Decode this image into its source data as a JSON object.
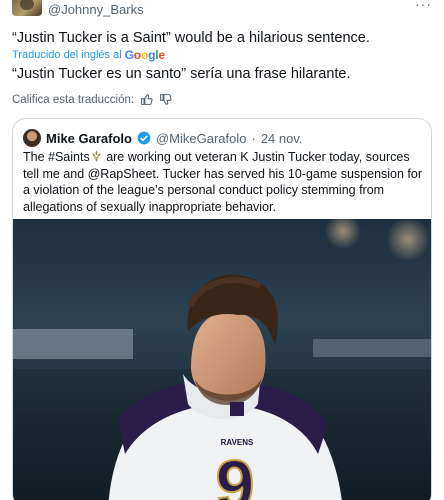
{
  "header": {
    "handle": "@Johnny_Barks",
    "avatar_icon": "user-avatar",
    "more_icon": "more-options-icon"
  },
  "tweet": {
    "text": "“Justin Tucker is a Saint” would be a hilarious sentence.",
    "translated_prefix": "Traducido del inglés al",
    "translated_provider": "Google",
    "translation": "“Justin Tucker es un santo” sería una frase hilarante.",
    "rate_label": "Califica esta traducción:"
  },
  "quote": {
    "name": "Mike Garafolo",
    "handle": "@MikeGarafolo",
    "separator": "·",
    "date": "24 nov.",
    "body_before": "The #Saints",
    "body_after": " are working out veteran K Justin Tucker today, sources tell me and @RapSheet. Tucker has served his 10-game suspension for a violation of the league’s personal conduct policy stemming from allegations of sexually inappropriate behavior.",
    "image_icon": "player-photo",
    "jersey_text": "RAVENS",
    "jersey_number": "9"
  },
  "colors": {
    "link": "#1d9bf0",
    "muted": "#536471",
    "text": "#0f1419",
    "border": "#cfd9de"
  }
}
